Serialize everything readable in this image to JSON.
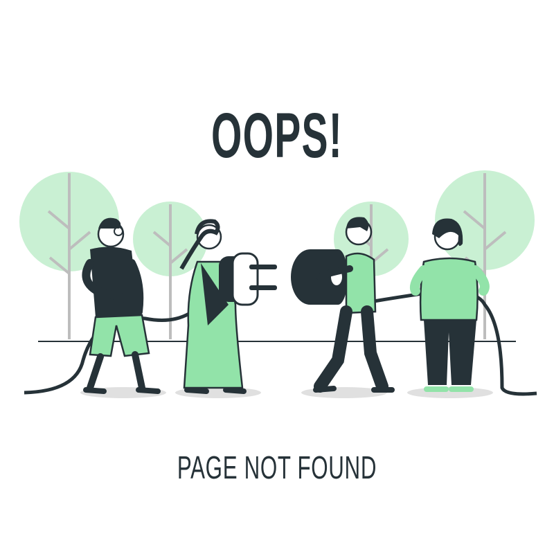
{
  "headline": "OOPS!",
  "subline": "PAGE NOT FOUND",
  "colors": {
    "ink": "#263238",
    "accent_green": "#92E3A9",
    "tree_green": "#C9F0D3",
    "trunk_gray": "#BDBDBD",
    "shadow_gray": "#E0E0E0"
  },
  "illustration": {
    "scene": "people-connecting-plug-icon"
  }
}
